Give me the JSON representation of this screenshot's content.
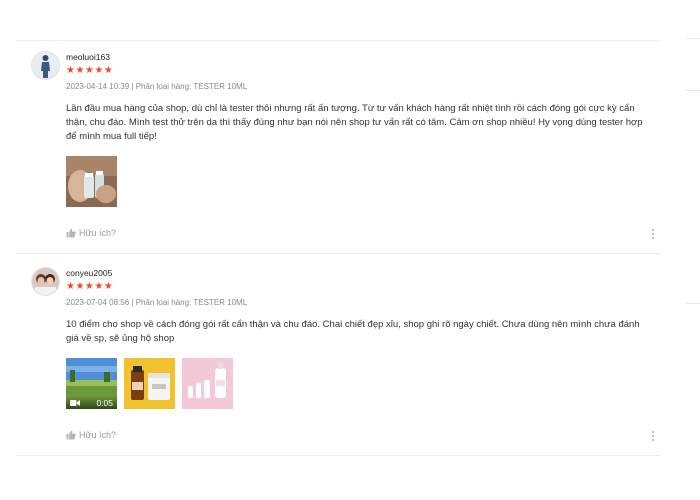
{
  "reviews": [
    {
      "username": "meoluoi163",
      "stars": "★★★★★",
      "rating": 5,
      "meta": "2023-04-14 10:39 | Phân loại hàng: TESTER 10ML",
      "body": "Lần đầu mua hàng của shop, dù chỉ là tester thôi nhưng rất ấn tượng. Từ tư vấn khách hàng rất nhiệt tình rồi cách đóng gói cực kỳ cẩn thận, chu đáo. Mình test thử trên da thì thấy đúng như bạn nói nên shop tư vấn rất có tâm. Cảm ơn shop nhiều! Hy vọng dùng tester hợp để mình mua full tiếp!",
      "helpful_label": "Hữu ích?",
      "avatar_icon": "person-standing-avatar",
      "media_icons": [
        "hand-holding-bottles-photo"
      ]
    },
    {
      "username": "conyeu2005",
      "stars": "★★★★★",
      "rating": 5,
      "meta": "2023-07-04 08:56 | Phân loại hàng: TESTER 10ML",
      "body": "10 điểm cho shop về cách đóng gói rất cẩn thận và chu đáo. Chai chiết đẹp xỉu, shop ghi rõ ngày chiết. Chưa dùng nên mình chưa đánh giá về sp, sẽ ủng hộ shop",
      "helpful_label": "Hữu ích?",
      "avatar_icon": "couple-photo-avatar",
      "video_duration": "0:05",
      "media_icons": [
        "field-video-thumbnail",
        "yellow-product-photo",
        "pink-bottles-photo"
      ]
    }
  ],
  "colors": {
    "star": "#ee4d2d",
    "meta_text": "#8a8a8a",
    "body_text": "#333333",
    "helpful_text": "#9a9a9a"
  }
}
